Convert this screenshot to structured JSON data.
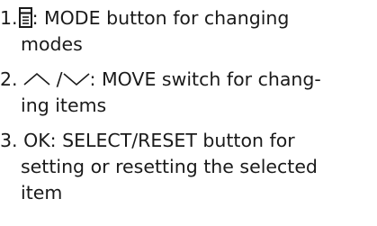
{
  "items": [
    {
      "number": "1.",
      "icon": "mode-icon",
      "text_line1": ": MODE button for changing",
      "text_line2": "modes"
    },
    {
      "number": "2.",
      "icon_up": "chevron-up-icon",
      "separator": " /",
      "icon_down": "chevron-down-icon",
      "text_line1": ": MOVE switch for chang-",
      "text_line2": "ing items"
    },
    {
      "number": "3.",
      "text_line1": "OK: SELECT/RESET button for",
      "text_line2": "setting or resetting the selected",
      "text_line3": "item"
    }
  ]
}
